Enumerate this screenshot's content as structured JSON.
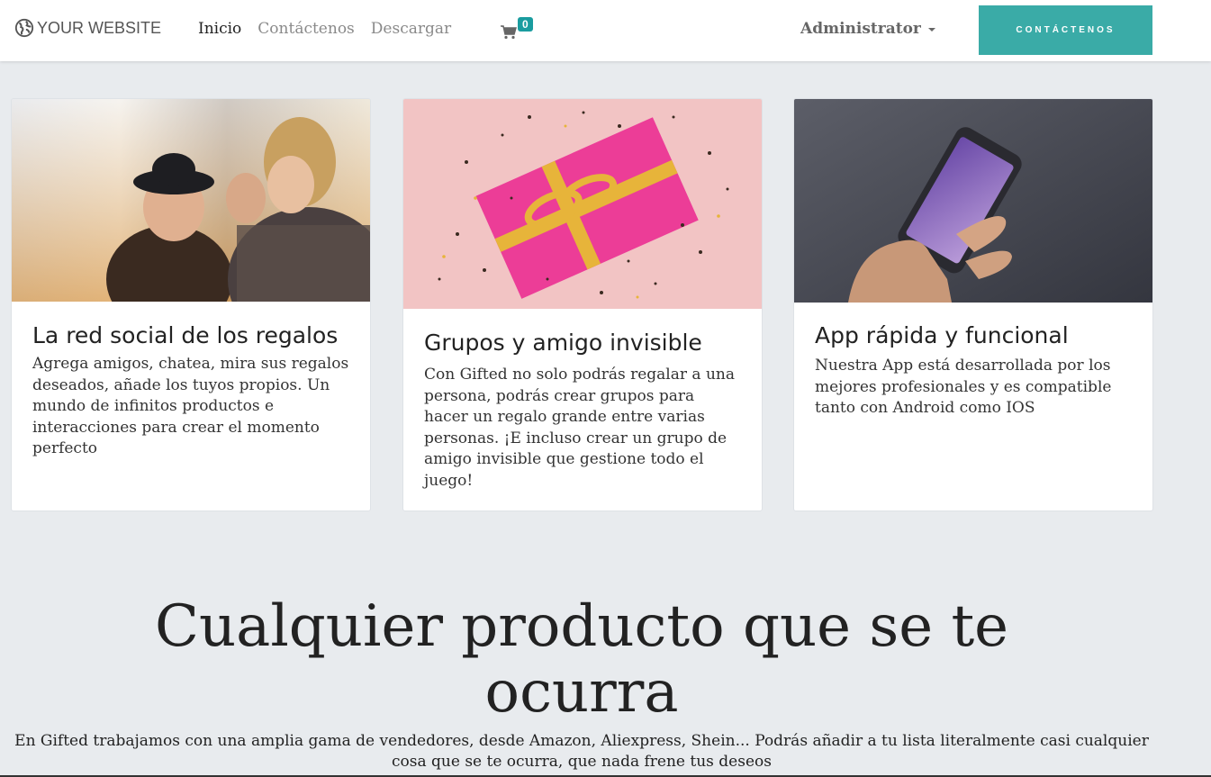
{
  "navbar": {
    "brand": "YOUR WEBSITE",
    "links": [
      {
        "label": "Inicio",
        "active": true
      },
      {
        "label": "Contáctenos",
        "active": false
      },
      {
        "label": "Descargar",
        "active": false
      }
    ],
    "cart_count": "0",
    "user_menu": "Administrator",
    "cta_label": "CONTÁCTENOS",
    "accent_color": "#3aaba7"
  },
  "cards": [
    {
      "title": "La red social de los regalos",
      "text": "Agrega amigos, chatea, mira sus regalos deseados, añade los tuyos propios. Un mundo de infinitos productos e interacciones para crear el momento perfecto"
    },
    {
      "title": "Grupos y amigo invisible",
      "text": "Con Gifted no solo podrás regalar a una persona, podrás crear grupos para hacer un regalo grande entre varias personas. ¡E incluso crear un grupo de amigo invisible que gestione todo el juego!"
    },
    {
      "title": "App rápida y funcional",
      "text": "Nuestra App está desarrollada por los mejores profesionales y es compatible tanto con Android como IOS"
    }
  ],
  "hero": {
    "title": "Cualquier producto que se te ocurra",
    "text": "En Gifted trabajamos con una amplia gama de vendedores, desde Amazon, Aliexpress, Shein... Podrás añadir a tu lista literalmente casi cualquier cosa que se te ocurra, que nada frene tus deseos"
  }
}
